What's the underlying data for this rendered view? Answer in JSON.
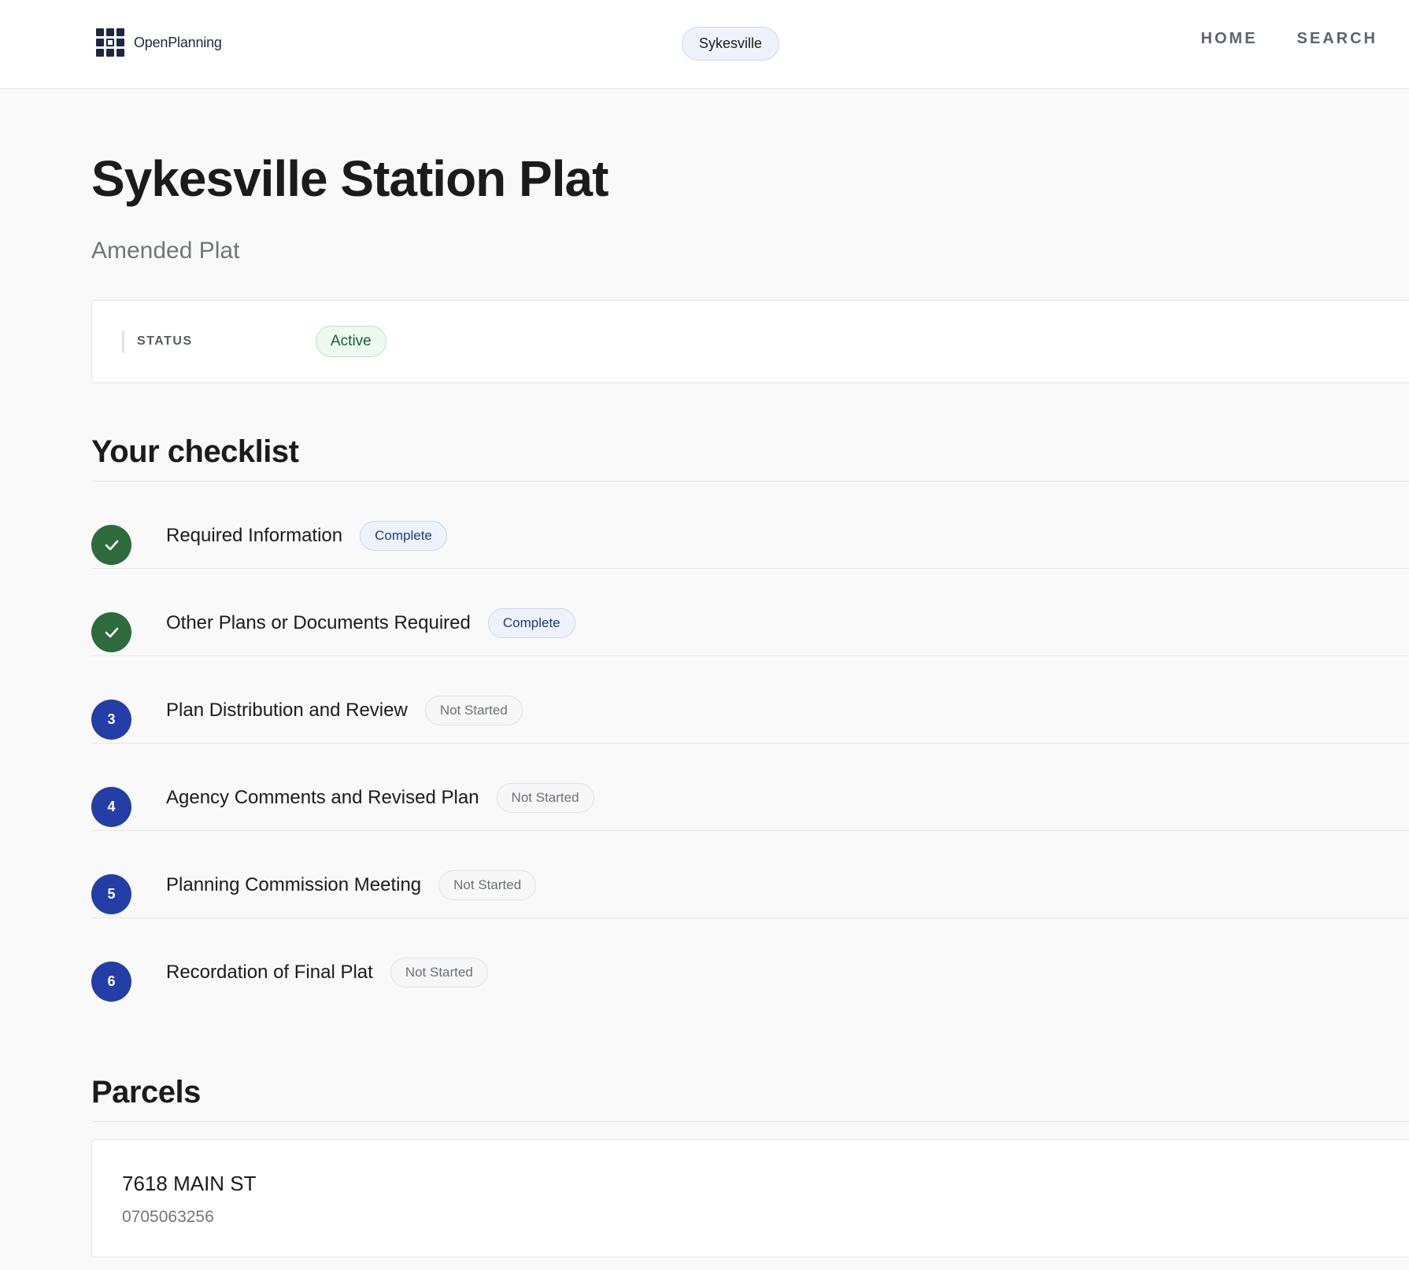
{
  "header": {
    "logo_text": "OpenPlanning",
    "jurisdiction": "Sykesville",
    "nav": [
      {
        "label": "HOME"
      },
      {
        "label": "SEARCH"
      }
    ]
  },
  "page": {
    "title": "Sykesville Station Plat",
    "subtitle": "Amended Plat"
  },
  "status": {
    "label": "STATUS",
    "value": "Active",
    "color": "#1b5e2b"
  },
  "checklist": {
    "heading": "Your checklist",
    "items": [
      {
        "marker": "",
        "icon": "check-icon",
        "state": "done",
        "title": "Required Information",
        "badge": "Complete"
      },
      {
        "marker": "",
        "icon": "check-icon",
        "state": "done",
        "title": "Other Plans or Documents Required",
        "badge": "Complete"
      },
      {
        "marker": "3",
        "state": "todo",
        "title": "Plan Distribution and Review",
        "badge": "Not Started"
      },
      {
        "marker": "4",
        "state": "todo",
        "title": "Agency Comments and Revised Plan",
        "badge": "Not Started"
      },
      {
        "marker": "5",
        "state": "todo",
        "title": "Planning Commission Meeting",
        "badge": "Not Started"
      },
      {
        "marker": "6",
        "state": "todo",
        "title": "Recordation of Final Plat",
        "badge": "Not Started"
      }
    ]
  },
  "parcels": {
    "heading": "Parcels",
    "items": [
      {
        "address": "7618 MAIN ST",
        "number": "0705063256"
      }
    ]
  },
  "colors": {
    "done": "#2e6b3c",
    "todo": "#233ea6",
    "brand": "#1d2740"
  }
}
